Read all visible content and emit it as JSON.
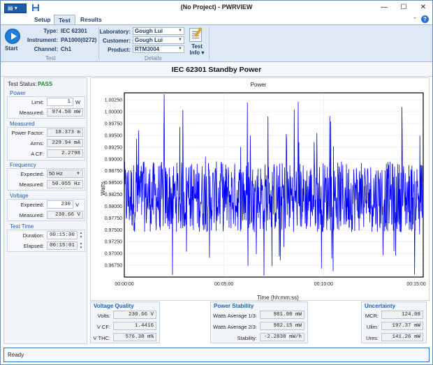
{
  "window": {
    "title": "(No Project) - PWRVIEW",
    "min": "—",
    "max": "☐",
    "close": "✕"
  },
  "ribbon_tabs": [
    "Setup",
    "Test",
    "Results"
  ],
  "ribbon": {
    "start_label": "Start",
    "type_label": "Type:",
    "type_value": "IEC 62301",
    "instrument_label": "Instrument:",
    "instrument_value": "PA1000(0272)",
    "channel_label": "Channel:",
    "channel_value": "Ch1",
    "test_group_caption": "Test",
    "laboratory_label": "Laboratory:",
    "laboratory_value": "Gough Lui",
    "customer_label": "Customer:",
    "customer_value": "Gough Lui",
    "product_label": "Product:",
    "product_value": "RTM3004",
    "test_info_label": "Test Info",
    "details_group_caption": "Details",
    "help": "?"
  },
  "main_title": "IEC 62301 Standby Power",
  "left": {
    "test_status_label": "Test Status:",
    "test_status_value": "PASS",
    "power": {
      "head": "Power",
      "limit_label": "Limit:",
      "limit_value": "1",
      "limit_unit": "W",
      "measured_label": "Measured:",
      "measured_value": "974.50 mW"
    },
    "measured": {
      "head": "Measured",
      "pf_label": "Power Factor:",
      "pf_value": "18.373 m",
      "arms_label": "Arms:",
      "arms_value": "229.94 mA",
      "acf_label": "A CF:",
      "acf_value": "2.2798"
    },
    "frequency": {
      "head": "Frequency",
      "expected_label": "Expected:",
      "expected_value": "50 Hz",
      "measured_label": "Measured:",
      "measured_value": "50.055 Hz"
    },
    "voltage": {
      "head": "Voltage",
      "expected_label": "Expected:",
      "expected_value": "230",
      "expected_unit": "V",
      "measured_label": "Measured:",
      "measured_value": "230.66 V"
    },
    "test_time": {
      "head": "Test Time",
      "duration_label": "Duration:",
      "duration_value": "00:15:00",
      "elapsed_label": "Elapsed:",
      "elapsed_value": "00:15:01"
    }
  },
  "chart_data": {
    "type": "line",
    "title": "Power",
    "xlabel": "Time (hh:mm:ss)",
    "ylabel": "Watts",
    "x_ticks": [
      "00:00:00",
      "00:05:00",
      "00:10:00",
      "00:15:00"
    ],
    "xlim_seconds": [
      0,
      900
    ],
    "ylim": [
      0.965,
      1.004
    ],
    "y_ticks": [
      0.9675,
      0.97,
      0.9725,
      0.975,
      0.9775,
      0.98,
      0.9825,
      0.985,
      0.9875,
      0.99,
      0.9925,
      0.995,
      0.9975,
      1.0,
      1.0025
    ],
    "y_tick_labels": [
      "0.96750",
      "0.97000",
      "0.97250",
      "0.97500",
      "0.97750",
      "0.98000",
      "0.98250",
      "0.98500",
      "0.98750",
      "0.99000",
      "0.99250",
      "0.99500",
      "0.99750",
      "1.00000",
      "1.00250"
    ],
    "series": [
      {
        "color": "#0000ff",
        "mean": 0.9825,
        "typical_band": [
          0.9745,
          0.9895
        ],
        "max": 1.0037,
        "min": 0.9653
      }
    ],
    "grid": true,
    "legend": "none"
  },
  "bottom": {
    "voltage_quality": {
      "head": "Voltage Quality",
      "volts_label": "Volts:",
      "volts_value": "230.66 V",
      "vcf_label": "V CF:",
      "vcf_value": "1.4416",
      "vthc_label": "V THC:",
      "vthc_value": "576.38 m%"
    },
    "power_stability": {
      "head": "Power Stability",
      "avg13_label": "Watts Average 1/3:",
      "avg13_value": "981.98 mW",
      "avg23_label": "Watts Average 2/3:",
      "avg23_value": "982.15 mW",
      "stability_label": "Stability:",
      "stability_value": "-2.2838 mW/h"
    },
    "uncertainty": {
      "head": "Uncertainty",
      "mcr_label": "MCR:",
      "mcr_value": "124.08",
      "ulim_label": "Ulim:",
      "ulim_value": "197.37 mW",
      "ures_label": "Ures:",
      "ures_value": "141.26 mW"
    }
  },
  "status": "Ready",
  "colors": {
    "accent": "#1c5aa8",
    "pass": "#1a8a2a",
    "series": "#0000ff",
    "section_head": "#1f5fb0"
  }
}
